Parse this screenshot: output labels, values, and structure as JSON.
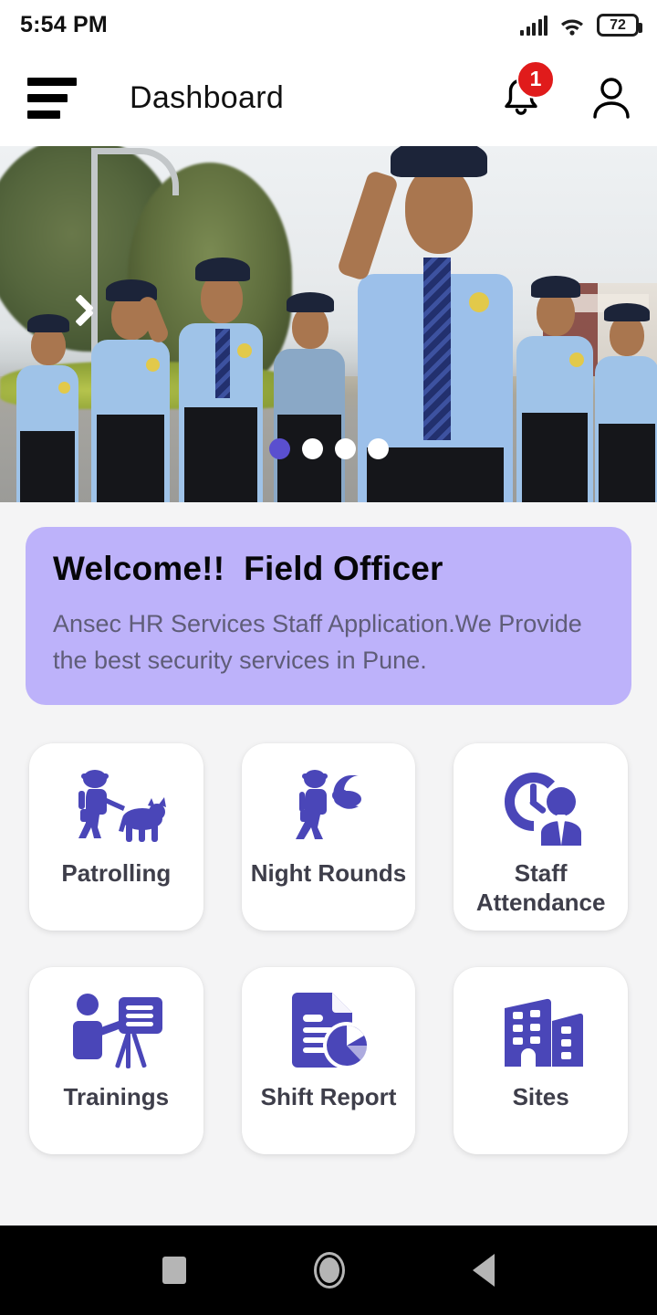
{
  "status_bar": {
    "time": "5:54 PM",
    "battery_percent": "72",
    "signal_icon": "cellular-signal-icon",
    "wifi_icon": "wifi-icon",
    "battery_icon": "battery-icon"
  },
  "app_bar": {
    "menu_icon": "hamburger-menu-icon",
    "title": "Dashboard",
    "notification_icon": "bell-icon",
    "notification_count": "1",
    "profile_icon": "account-person-icon"
  },
  "carousel": {
    "prev_icon": "chevron-left-icon",
    "slide_count": 4,
    "active_index": 0,
    "alt": "Security guards in light blue uniforms saluting"
  },
  "welcome": {
    "heading": "Welcome!!  Field Officer",
    "description": "Ansec HR Services Staff Application.We Provide the best security services in Pune."
  },
  "tiles": [
    {
      "label": "Patrolling",
      "icon": "guard-with-dog-icon"
    },
    {
      "label": "Night Rounds",
      "icon": "guard-walking-moon-icon"
    },
    {
      "label": "Staff Attendance",
      "icon": "clock-person-icon"
    },
    {
      "label": "Trainings",
      "icon": "presenter-board-icon"
    },
    {
      "label": "Shift Report",
      "icon": "document-pie-chart-icon"
    },
    {
      "label": "Sites",
      "icon": "buildings-icon"
    }
  ],
  "nav_bar": {
    "recents_icon": "square-recents-icon",
    "home_icon": "circle-home-icon",
    "back_icon": "triangle-back-icon"
  },
  "colors": {
    "accent_purple": "#4a46b8",
    "welcome_card": "#bdb2fa",
    "badge_red": "#e01b1b",
    "page_background": "#f4f4f5",
    "active_dot": "#5a4fcf"
  }
}
